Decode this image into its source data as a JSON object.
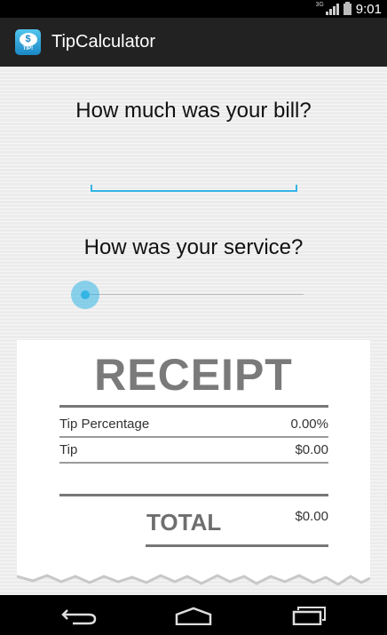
{
  "status_bar": {
    "network": "3G",
    "time": "9:01"
  },
  "action_bar": {
    "title": "TipCalculator",
    "icon": "tip-calculator-app-icon",
    "icon_text": "$",
    "icon_caption": "TIP!"
  },
  "form": {
    "bill_question": "How much was your bill?",
    "bill_value": "",
    "service_question": "How was your service?",
    "service_slider_value": 0
  },
  "receipt": {
    "heading": "RECEIPT",
    "tip_percentage_label": "Tip Percentage",
    "tip_percentage_value": "0.00%",
    "tip_label": "Tip",
    "tip_value": "$0.00",
    "total_label": "TOTAL",
    "total_value": "$0.00"
  },
  "nav_bar": {
    "back_icon": "back-icon",
    "home_icon": "home-icon",
    "recents_icon": "recent-apps-icon"
  },
  "colors": {
    "accent": "#33b5e5",
    "action_bar": "#222222",
    "background": "#ececec"
  }
}
